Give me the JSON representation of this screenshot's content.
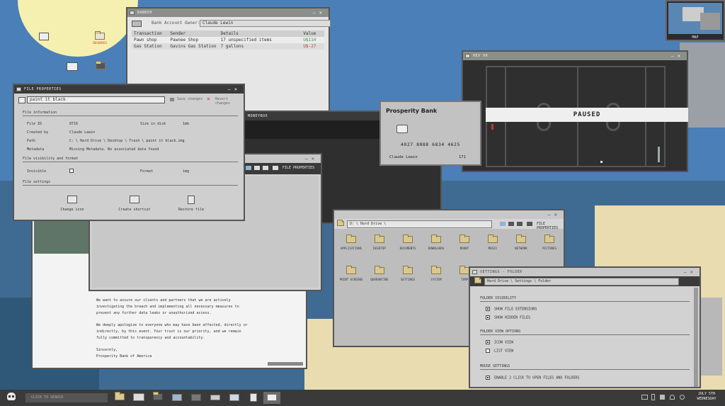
{
  "desktop": {
    "icons_top": [
      {
        "label": ""
      },
      {
        "label": "RESEARCH"
      }
    ],
    "icons_mid": [
      {
        "label": ""
      },
      {
        "label": ""
      }
    ]
  },
  "banker": {
    "title": "BANKER",
    "owner_label": "Bank Account Owner:",
    "owner_value": "Claude Lewin",
    "columns": [
      "Transaction",
      "Sender",
      "Details",
      "Value"
    ],
    "rows": [
      {
        "transaction": "Pawn shop",
        "sender": "Pawnee Shop",
        "details": "17 unspecified items",
        "value": "U$114"
      },
      {
        "transaction": "Gas Station",
        "sender": "Gavins Gas Station",
        "details": "7 gallons",
        "value": "U$-27"
      }
    ]
  },
  "file_properties": {
    "title": "FILE PROPERTIES",
    "filename": "paint it black",
    "save_label": "Save changes",
    "revert_label": "Revert changes",
    "section_info": "File information",
    "file_id_label": "File ID",
    "file_id_value": "8716",
    "size_label": "Size in disk",
    "size_value": "1mb",
    "created_label": "Created by",
    "created_value": "Claude Lewin",
    "path_label": "Path",
    "path_value": "C: \\ Hard Drive \\ Desktop \\ Trash \\ paint it black.img",
    "metadata_label": "Metadata",
    "metadata_value": "Missing Metadata. No associated data found",
    "section_visibility": "File visibility and format",
    "invisible_label": "Invisible",
    "format_label": "Format",
    "format_value": "img",
    "section_settings": "File settings",
    "actions": [
      "Change icon",
      "Create shortcut",
      "Restore file"
    ]
  },
  "moneybox": {
    "title": "MONEYBOX"
  },
  "file_properties_2": {
    "title": "FILE PROPERTIES"
  },
  "bank_card": {
    "bank_name": "Prosperity Bank",
    "number": "4027 8088 6834 4625",
    "holder": "Claude Lewin",
    "cvv": "171"
  },
  "hex_99": {
    "title": "HEX 99",
    "paused_label": "PAUSED"
  },
  "explorer": {
    "path": "D: \\ Hard Drive \\",
    "title": "FILE PROPERTIES",
    "folders": [
      "APPLICATIONS",
      "DESKTOP",
      "DOCUMENTS",
      "DOWNLOADS",
      "MOUNT",
      "MUSIC",
      "NETWORK",
      "PICTURES",
      "PRINT SCREENS",
      "QUARANTINE",
      "SETTINGS",
      "SYSTEM",
      "TEMP"
    ]
  },
  "letter": {
    "p1": "We want to assure our clients and partners that we are actively investigating the breach and implementing all necessary measures to prevent any further data leaks or unauthorized access.",
    "p2": "We deeply apologize to everyone who may have been affected, directly or indirectly, by this event. Your trust is our priority, and we remain fully committed to transparency and accountability.",
    "closing": "Sincerely,",
    "signature": "Prosperity Bank of America"
  },
  "settings": {
    "title": "SETTINGS - FOLDER",
    "path": "Hard Drive \\ Settings \\ Folder",
    "section_visibility": "FOLDER VISIBILITY",
    "show_ext": "SHOW FILE EXTENSIONS",
    "show_hidden": "SHOW HIDDEN FILES",
    "section_view": "FOLDER VIEW OPTIONS",
    "icon_view": "ICON VIEW",
    "list_view": "LIST VIEW",
    "section_mouse": "MOUSE SETTINGS",
    "double_click": "ENABLE 2 CLICK TO OPEN FILES AND FOLDERS"
  },
  "minimap": {
    "label": "MAP"
  },
  "taskbar": {
    "search_placeholder": "CLICK TO SEARCH",
    "date": "JULY 5TH",
    "day": "WEDNESDAY"
  },
  "colors": {
    "desktop_blue": "#4a7fb8",
    "sand": "#e9dcb0",
    "sun": "#f6f0b0",
    "window": "#d6d6d6",
    "titlebar": "#8a8f8a",
    "accent_red": "#c0392b"
  }
}
